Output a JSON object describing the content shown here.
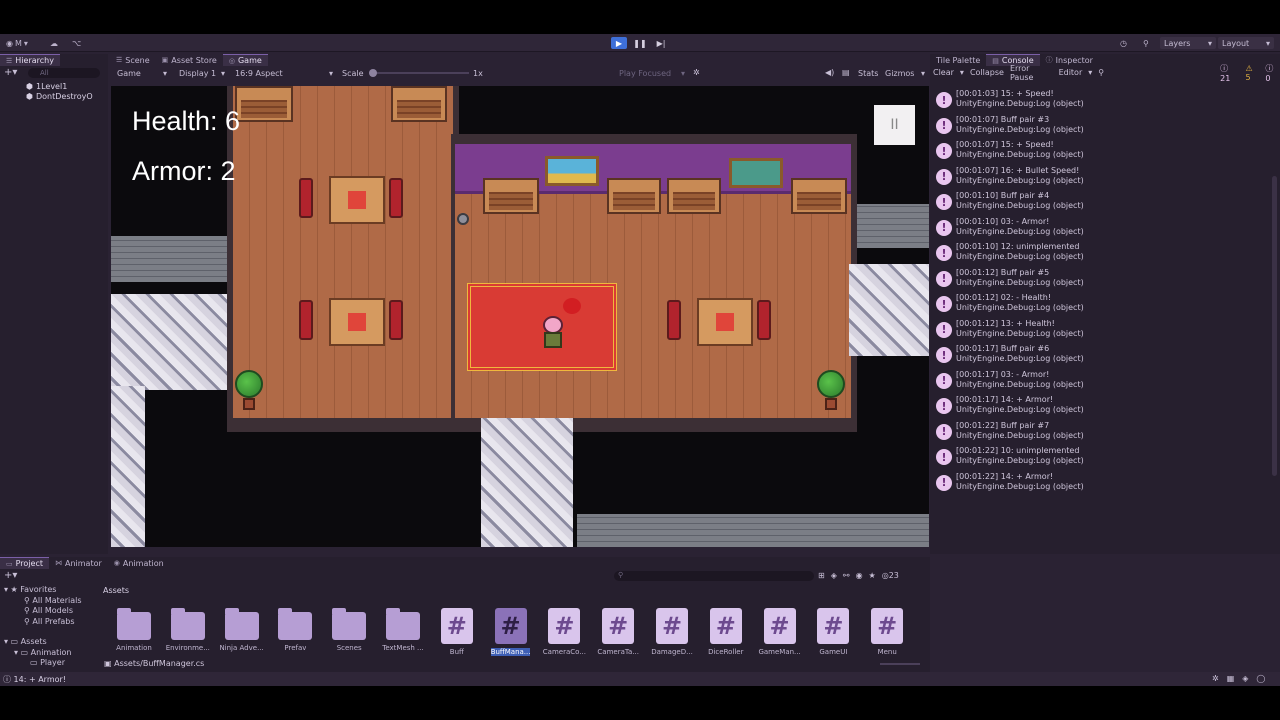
{
  "toolbar": {
    "account_label": "M",
    "layers_label": "Layers",
    "layout_label": "Layout"
  },
  "hierarchy": {
    "tab_label": "Hierarchy",
    "search_placeholder": "All",
    "items": [
      "1Level1",
      "DontDestroyO"
    ]
  },
  "center_tabs": [
    "Scene",
    "Asset Store",
    "Game"
  ],
  "game_toolbar": {
    "display_mode": "Game",
    "display": "Display 1",
    "aspect": "16:9 Aspect",
    "scale_label": "Scale",
    "scale_value": "1x",
    "play_focused": "Play Focused",
    "stats": "Stats",
    "gizmos": "Gizmos"
  },
  "hud": {
    "health": "Health: 6",
    "armor": "Armor: 2",
    "pause_glyph": "II"
  },
  "right_tabs": [
    "Tile Palette",
    "Console",
    "Inspector"
  ],
  "console_toolbar": {
    "clear": "Clear",
    "collapse": "Collapse",
    "error_pause": "Error Pause",
    "editor": "Editor",
    "info_count": "21",
    "warn_count": "5",
    "error_count": "0"
  },
  "console_entries": [
    {
      "line1": "[00:01:03] 15: + Speed!",
      "line2": "UnityEngine.Debug:Log (object)"
    },
    {
      "line1": "[00:01:07] Buff pair #3",
      "line2": "UnityEngine.Debug:Log (object)"
    },
    {
      "line1": "[00:01:07] 15: + Speed!",
      "line2": "UnityEngine.Debug:Log (object)"
    },
    {
      "line1": "[00:01:07] 16: + Bullet Speed!",
      "line2": "UnityEngine.Debug:Log (object)"
    },
    {
      "line1": "[00:01:10] Buff pair #4",
      "line2": "UnityEngine.Debug:Log (object)"
    },
    {
      "line1": "[00:01:10] 03: - Armor!",
      "line2": "UnityEngine.Debug:Log (object)"
    },
    {
      "line1": "[00:01:10] 12: unimplemented",
      "line2": "UnityEngine.Debug:Log (object)"
    },
    {
      "line1": "[00:01:12] Buff pair #5",
      "line2": "UnityEngine.Debug:Log (object)"
    },
    {
      "line1": "[00:01:12] 02: - Health!",
      "line2": "UnityEngine.Debug:Log (object)"
    },
    {
      "line1": "[00:01:12] 13: + Health!",
      "line2": "UnityEngine.Debug:Log (object)"
    },
    {
      "line1": "[00:01:17] Buff pair #6",
      "line2": "UnityEngine.Debug:Log (object)"
    },
    {
      "line1": "[00:01:17] 03: - Armor!",
      "line2": "UnityEngine.Debug:Log (object)"
    },
    {
      "line1": "[00:01:17] 14: + Armor!",
      "line2": "UnityEngine.Debug:Log (object)"
    },
    {
      "line1": "[00:01:22] Buff pair #7",
      "line2": "UnityEngine.Debug:Log (object)"
    },
    {
      "line1": "[00:01:22] 10: unimplemented",
      "line2": "UnityEngine.Debug:Log (object)"
    },
    {
      "line1": "[00:01:22] 14: + Armor!",
      "line2": "UnityEngine.Debug:Log (object)"
    }
  ],
  "bottom_tabs": [
    "Project",
    "Animator",
    "Animation"
  ],
  "project": {
    "favorites_label": "Favorites",
    "favorites": [
      "All Materials",
      "All Models",
      "All Prefabs"
    ],
    "assets_label": "Assets",
    "tree": [
      "Assets",
      "Animation",
      "Player"
    ],
    "breadcrumb": "Assets",
    "asset_count": "23",
    "selected_path": "Assets/BuffManager.cs",
    "folders": [
      "Animation",
      "Environme...",
      "Ninja Adve...",
      "Prefav",
      "Scenes",
      "TextMesh ..."
    ],
    "scripts": [
      "Buff",
      "BuffMana...",
      "CameraCo...",
      "CameraTa...",
      "DamageD...",
      "DiceRoller",
      "GameMan...",
      "GameUI",
      "Menu"
    ]
  },
  "status": {
    "message": "14: + Armor!"
  }
}
